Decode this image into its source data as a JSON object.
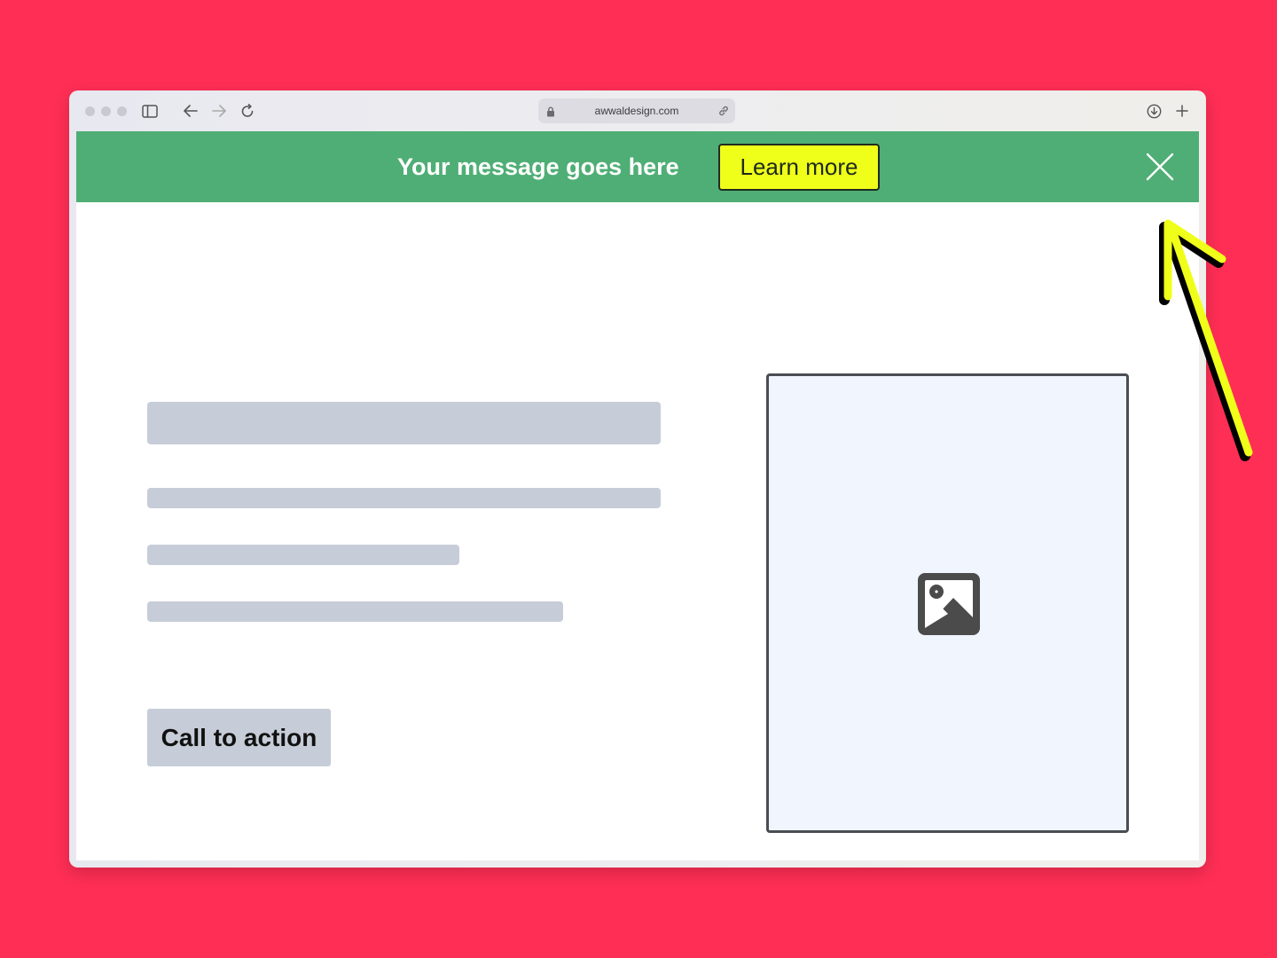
{
  "browser": {
    "url": "awwaldesign.com",
    "icons": {
      "window_controls": [
        "close-dot",
        "minimize-dot",
        "zoom-dot"
      ],
      "sidebar": "sidebar-icon",
      "back": "arrow-left-icon",
      "forward": "arrow-right-icon",
      "reload": "reload-icon",
      "lock": "lock-icon",
      "share_link": "link-icon",
      "downloads": "download-icon",
      "new_tab": "plus-icon"
    }
  },
  "banner": {
    "message": "Your message goes here",
    "learn_more_label": "Learn more",
    "close_icon": "close-icon",
    "background_color": "#4fae75",
    "button_color": "#f0ff1a"
  },
  "content": {
    "cta_label": "Call to action",
    "image_placeholder_icon": "image-icon",
    "skeleton_color": "#c6cdd8"
  },
  "annotation": {
    "icon": "arrow-annotation",
    "color": "#f0ff1a"
  },
  "page_background": "#ff2e55"
}
